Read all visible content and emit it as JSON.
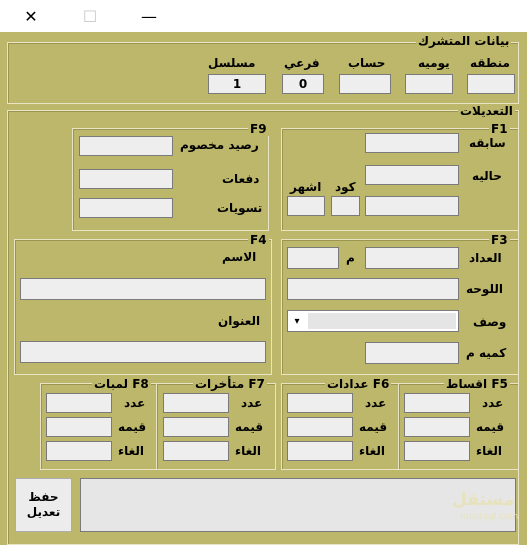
{
  "window": {
    "close_glyph": "✕",
    "maximize_glyph": "☐",
    "minimize_glyph": "—"
  },
  "subscriber": {
    "title": "بيانات المتشرك",
    "serial_label": "مسلسل",
    "serial_value": "1",
    "branch_label": "فرعي",
    "branch_value": "0",
    "account_label": "حساب",
    "account_value": "",
    "daily_label": "يوميه",
    "daily_value": "",
    "region_label": "منطقه",
    "region_value": ""
  },
  "edits": {
    "title": "التعديلات",
    "f1": {
      "title": "F1",
      "previous_label": "سابقه",
      "current_label": "حاليه",
      "code_label": "كود",
      "months_label": "اشهر"
    },
    "f9": {
      "title": "F9",
      "reserved_balance_label": "رصيد مخصوم",
      "payments_label": "دفعات",
      "settlements_label": "تسويات"
    },
    "f3": {
      "title": "F3",
      "meter_label": "العداد",
      "m_label": "م",
      "plate_label": "اللوحه",
      "description_label": "وصف",
      "quantity_label": "كميه م"
    },
    "f4": {
      "title": "F4",
      "name_label": "الاسم",
      "address_label": "العنوان"
    },
    "f5": {
      "title": "F5",
      "heading": "اقساط",
      "count_label": "عدد",
      "value_label": "قيمه",
      "cancel_label": "الغاء"
    },
    "f6": {
      "title": "F6",
      "heading": "عدادات",
      "count_label": "عدد",
      "value_label": "قيمه",
      "cancel_label": "الغاء"
    },
    "f7": {
      "title": "F7",
      "heading": "متأخرات",
      "count_label": "عدد",
      "value_label": "قيمه",
      "cancel_label": "الغاء"
    },
    "f8": {
      "title": "F8",
      "heading": "لمبات",
      "count_label": "عدد",
      "value_label": "قيمه",
      "cancel_label": "الغاء"
    }
  },
  "footer": {
    "save_line1": "حفظ",
    "save_line2": "تعديل",
    "watermark": "مستقل",
    "watermark_sub": "mostaql.com"
  },
  "colors": {
    "form_background": "#bdb76b",
    "field_background": "#eeeeee"
  }
}
